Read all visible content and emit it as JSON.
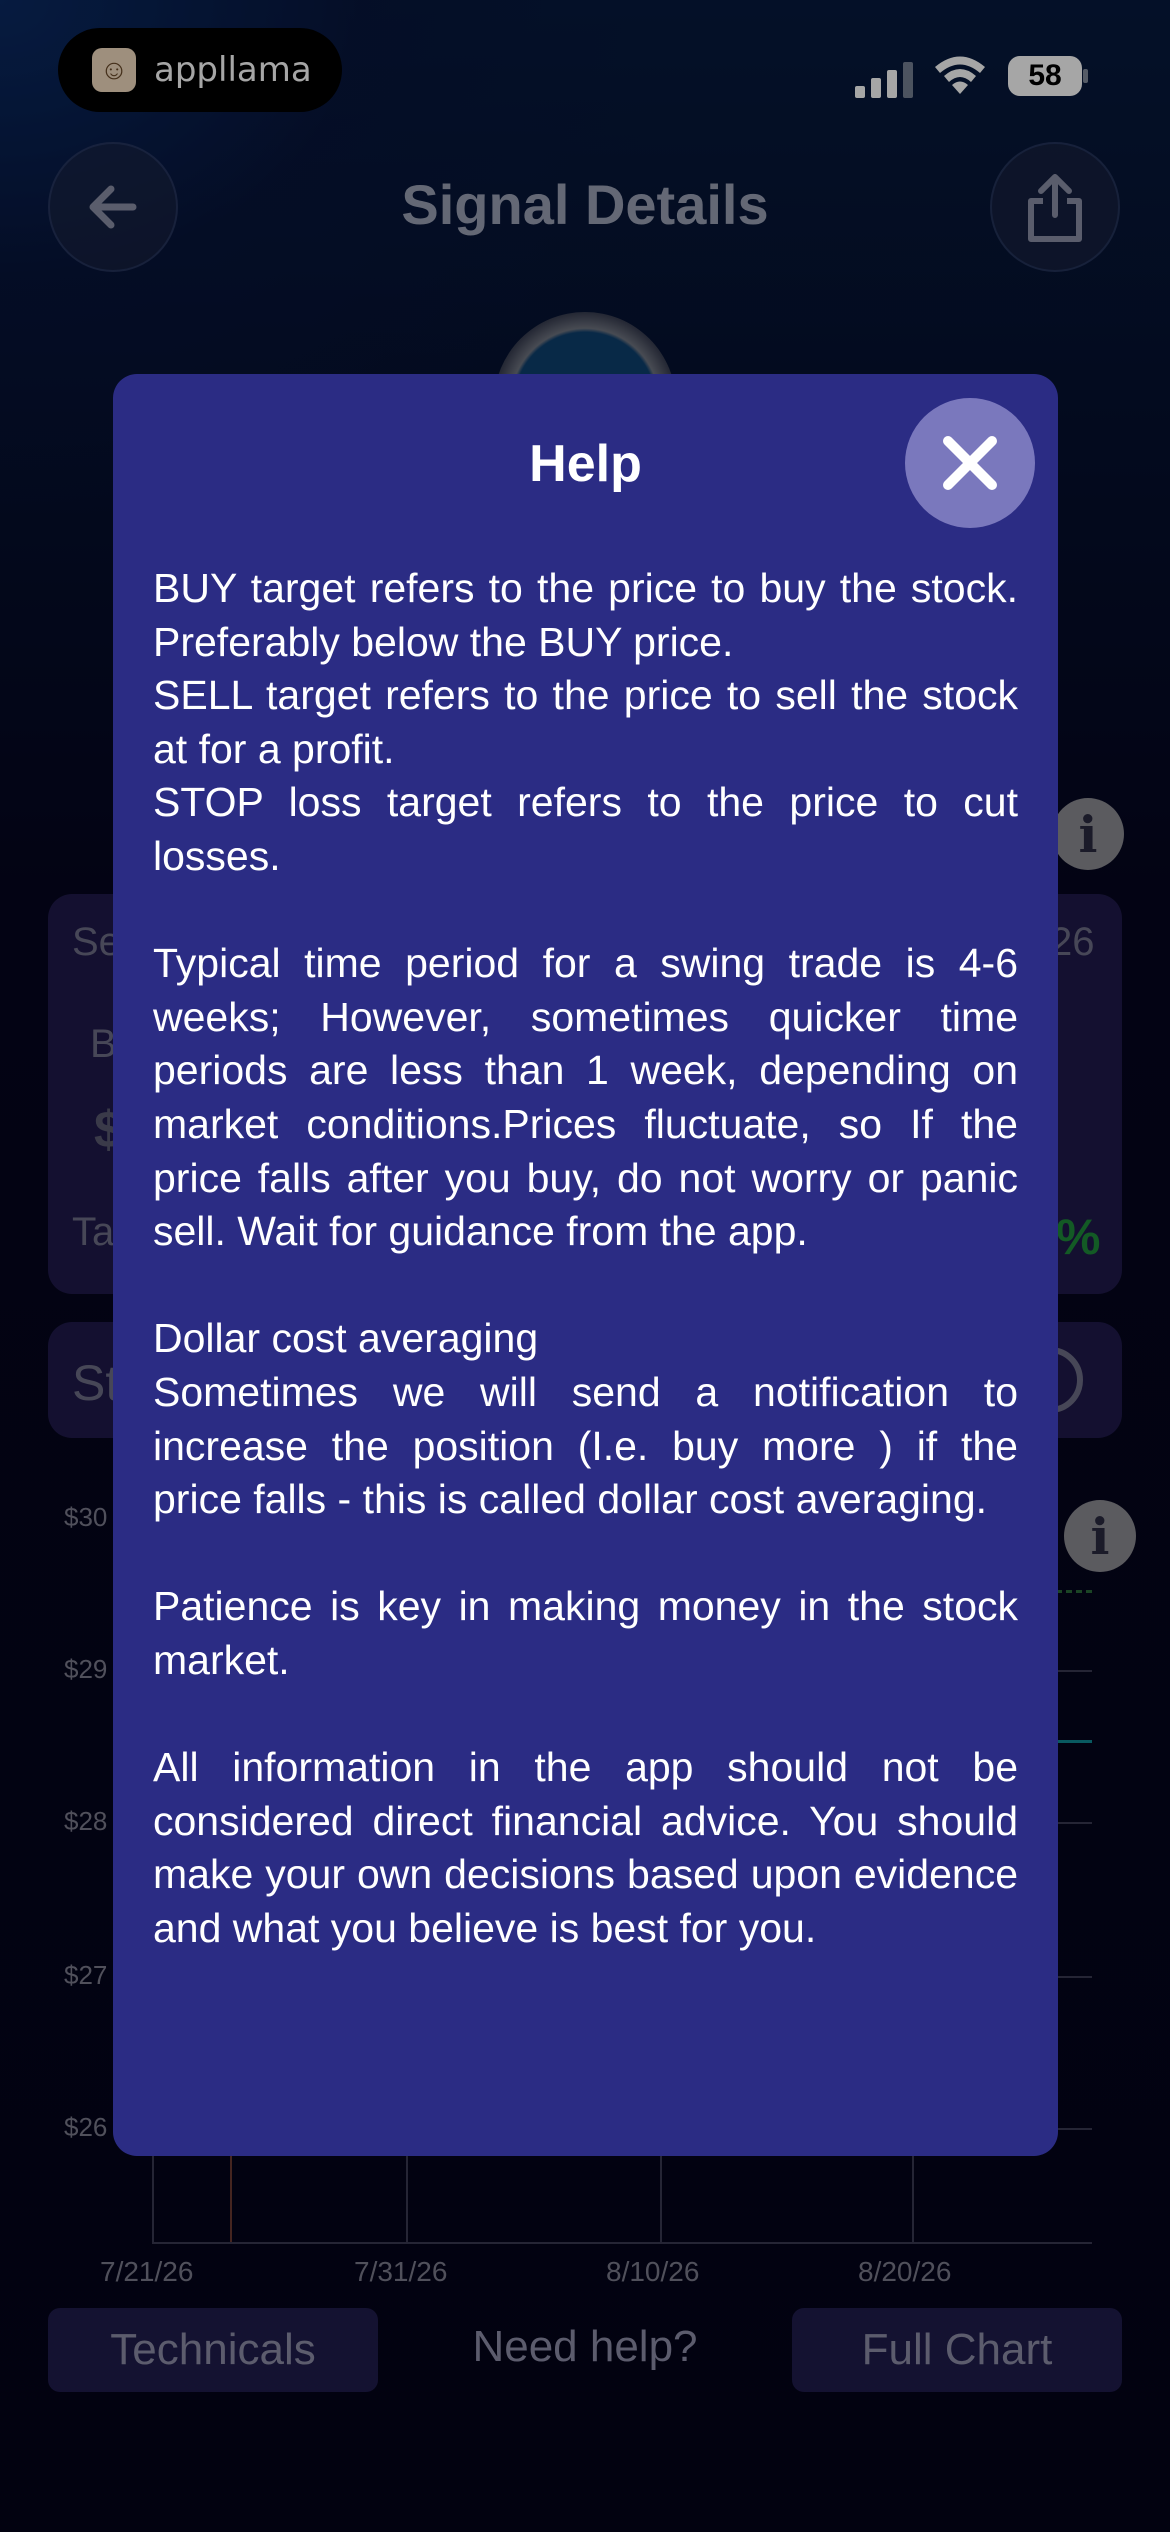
{
  "status_bar": {
    "app_label": "appllama",
    "battery": "58"
  },
  "header": {
    "title": "Signal Details"
  },
  "background": {
    "card_label_partial": "Se",
    "card_b_partial": "B",
    "card_dollar_partial": "$",
    "card_ta_partial": "Ta",
    "card_date_partial": "26",
    "card_pct_partial": "%",
    "strip_label_partial": "St",
    "y_axis_labels": [
      "$30",
      "$29",
      "$28",
      "$27",
      "$26"
    ],
    "x_axis_labels": [
      "7/21/26",
      "7/31/26",
      "8/10/26",
      "8/20/26"
    ]
  },
  "bottom_bar": {
    "technicals": "Technicals",
    "need_help": "Need help?",
    "full_chart": "Full Chart"
  },
  "modal": {
    "title": "Help",
    "paragraphs": [
      "BUY target refers to the price to buy the stock. Preferably below the BUY price.",
      "SELL target refers to the price to sell the stock at for a profit.",
      "STOP loss target refers to the price to cut losses.",
      "Typical time period for a swing trade is 4-6 weeks; However, sometimes quicker time periods are less than 1 week, depending on market conditions.Prices fluctuate, so If the price falls after you buy, do not worry or panic sell. Wait for guidance from the app.",
      "Dollar cost averaging",
      "Sometimes we will send a notification to increase the position (I.e. buy more ) if the price falls - this is called dollar cost averaging.",
      "Patience is key in making money in the stock market.",
      "All information in the app should not be considered direct financial advice. You should make your own decisions based upon evidence and what you believe is best for you."
    ]
  }
}
